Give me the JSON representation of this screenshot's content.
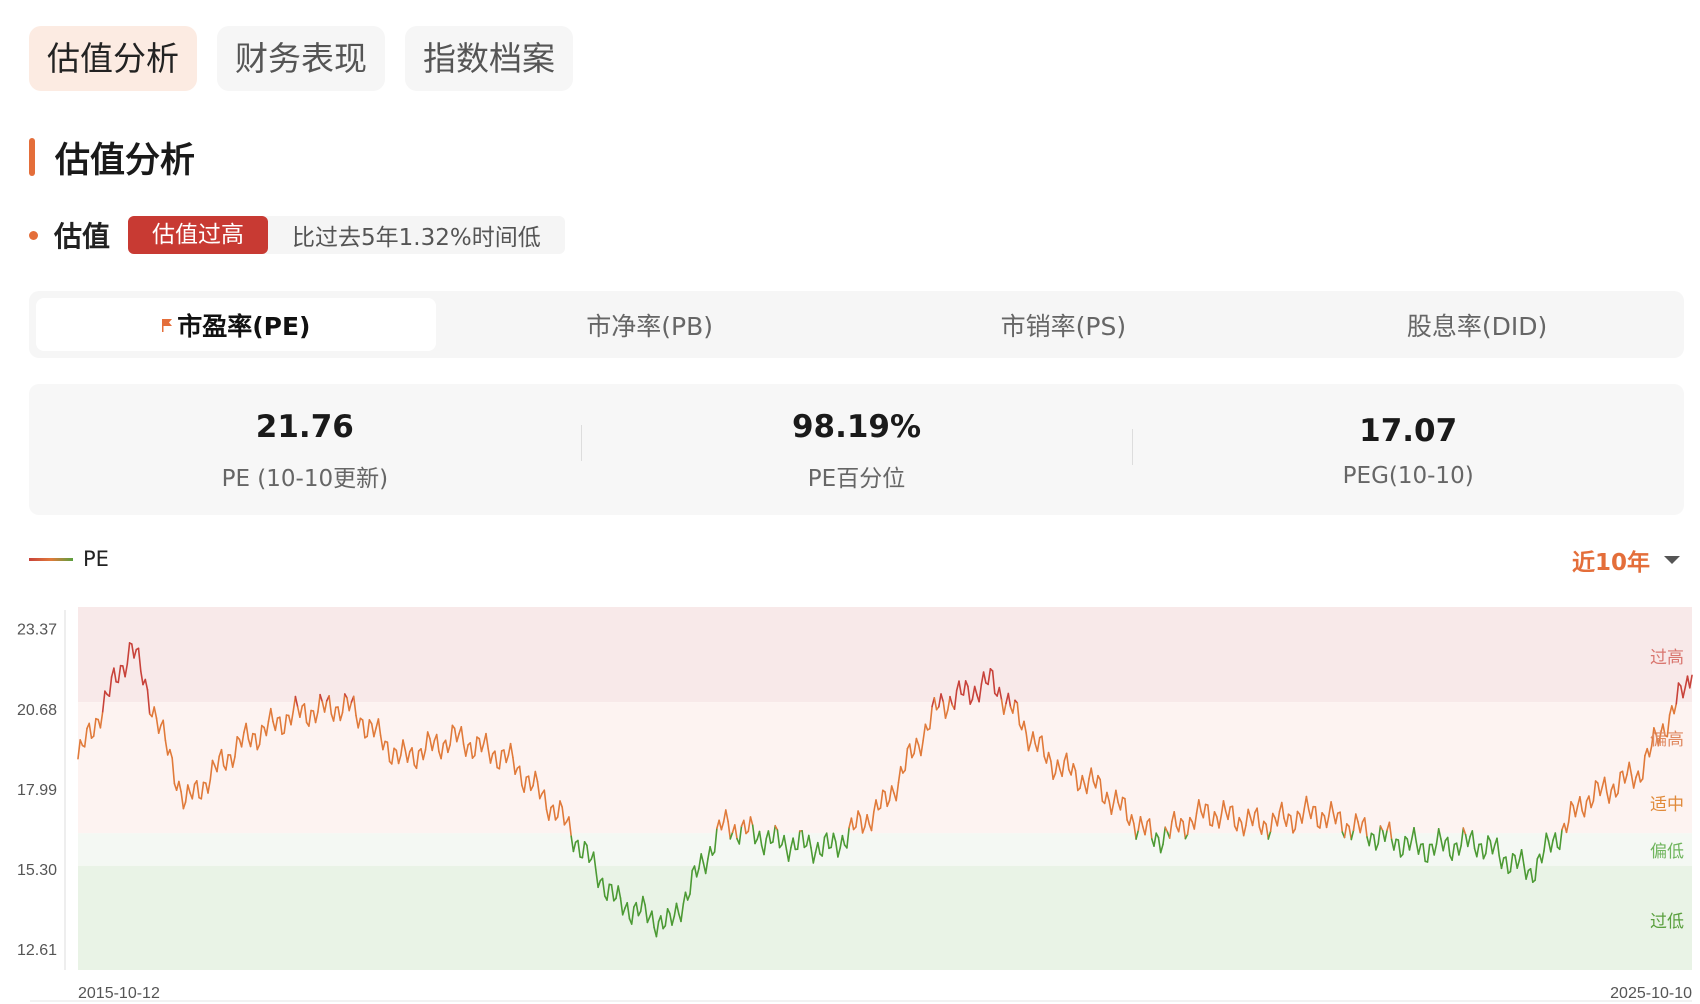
{
  "top_tabs": [
    "估值分析",
    "财务表现",
    "指数档案"
  ],
  "section_title": "估值分析",
  "valuation": {
    "label": "估值",
    "badge": "估值过高",
    "desc": "比过去5年1.32%时间低"
  },
  "metric_tabs": [
    "市盈率(PE)",
    "市净率(PB)",
    "市销率(PS)",
    "股息率(DID)"
  ],
  "stats": [
    {
      "value": "21.76",
      "label": "PE (10-10更新)"
    },
    {
      "value": "98.19%",
      "label": "PE百分位"
    },
    {
      "value": "17.07",
      "label": "PEG(10-10)"
    }
  ],
  "legend": "PE",
  "range_selector": "近10年",
  "colors": {
    "accent": "#e46e3a",
    "high": "#c8423a",
    "mid": "#e07a3a",
    "low": "#4c9a34"
  },
  "chart_data": {
    "type": "line",
    "series": [
      {
        "name": "PE",
        "x": [
          "2015-10-12",
          "2016-01",
          "2016-05",
          "2016-09",
          "2017-01",
          "2017-05",
          "2017-09",
          "2018-01",
          "2018-05",
          "2018-09",
          "2019-01",
          "2019-05",
          "2019-09",
          "2020-01",
          "2020-05",
          "2020-09",
          "2021-01",
          "2021-05",
          "2021-09",
          "2022-01",
          "2022-05",
          "2022-09",
          "2023-01",
          "2023-05",
          "2023-09",
          "2024-01",
          "2024-05",
          "2024-09",
          "2025-01",
          "2025-05",
          "2025-10-10"
        ],
        "values": [
          19.0,
          22.8,
          17.5,
          19.5,
          20.5,
          20.8,
          19.0,
          19.7,
          19.0,
          17.0,
          14.2,
          13.4,
          16.8,
          16.2,
          16.0,
          17.5,
          20.8,
          21.6,
          19.0,
          18.0,
          16.3,
          17.2,
          16.8,
          17.2,
          16.5,
          16.0,
          16.2,
          15.2,
          17.6,
          18.5,
          21.8
        ]
      }
    ],
    "y_ticks": [
      "23.37",
      "20.68",
      "17.99",
      "15.30",
      "12.61"
    ],
    "ylim": [
      11.9,
      24.1
    ],
    "x_tick_labels": [
      "2015-10-12",
      "2025-10-10"
    ],
    "zones": [
      "过高",
      "偏高",
      "适中",
      "偏低",
      "过低"
    ]
  }
}
